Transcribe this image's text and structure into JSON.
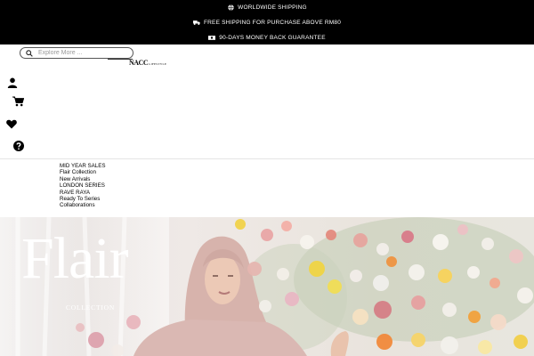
{
  "promo_bar": {
    "items": [
      {
        "icon": "globe-icon",
        "text": "WORLDWIDE SHIPPING"
      },
      {
        "icon": "truck-icon",
        "text": "FREE SHIPPING FOR PURCHASE ABOVE RM80"
      },
      {
        "icon": "money-icon",
        "text": "90-DAYS MONEY BACK GUARANTEE"
      }
    ]
  },
  "header": {
    "search": {
      "placeholder": "Explore More ...",
      "value": ""
    },
    "logo": {
      "main": "NACC",
      "sub": "LIFESTYLE"
    },
    "icons": [
      "user-icon",
      "cart-icon",
      "heart-icon",
      "help-icon"
    ]
  },
  "nav": {
    "items": [
      {
        "label": "MID YEAR SALES"
      },
      {
        "label": "Flair Collection"
      },
      {
        "label": "New Arrivals"
      },
      {
        "label": "LONDON SERIES"
      },
      {
        "label": "RAVE RAYA"
      },
      {
        "label": "Ready To Series"
      },
      {
        "label": "Collaborations"
      }
    ]
  },
  "hero": {
    "title": "Flair",
    "subtitle": "COLLECTION"
  },
  "colors": {
    "topbar_bg": "#000000",
    "topbar_text": "#ffffff",
    "hero_bg": "#ece6e2",
    "hijab": "#d9b5ae"
  }
}
